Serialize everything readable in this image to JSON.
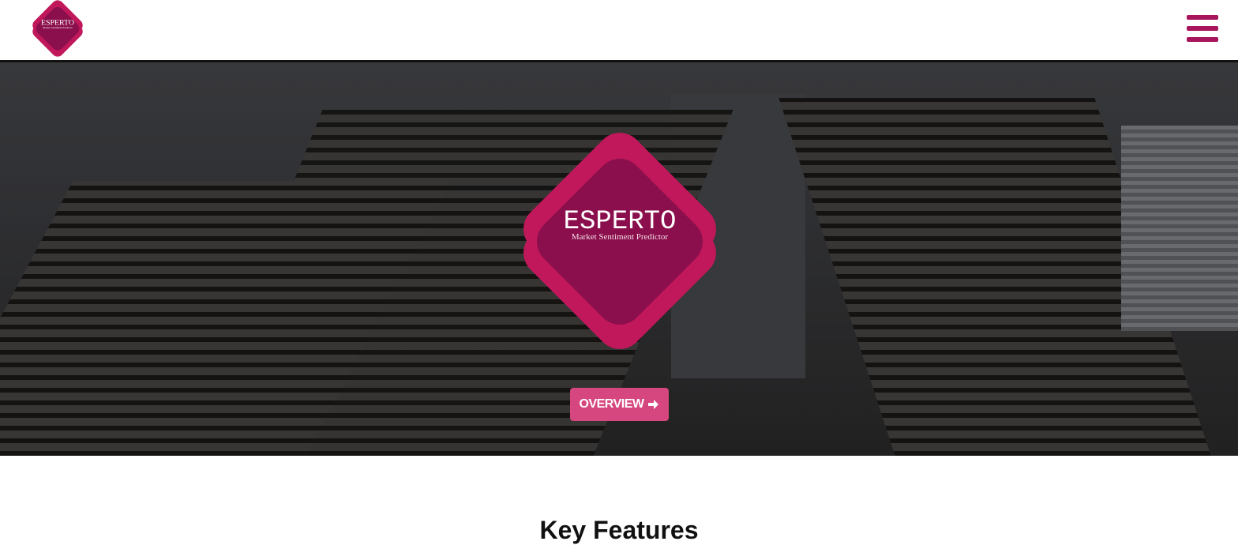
{
  "brand": {
    "name": "ESPERTO",
    "tagline": "Market Sentiment Predictor",
    "colors": {
      "outer": "#c0185a",
      "inner": "#8a0f4c",
      "button": "#d6467f",
      "menu": "#a8155c"
    }
  },
  "header": {
    "menu_icon": "hamburger-icon"
  },
  "hero": {
    "button_label": "OVERVIEW",
    "button_icon": "arrow-right-icon"
  },
  "sections": {
    "features_title": "Key Features"
  }
}
